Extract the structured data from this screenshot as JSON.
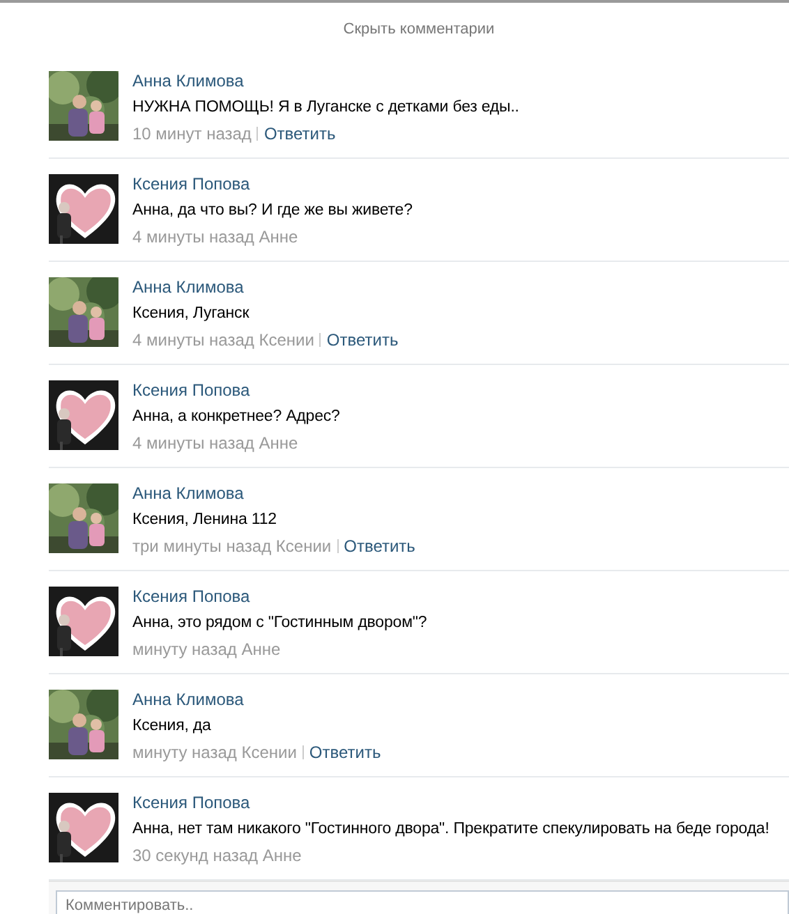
{
  "hide_link": "Скрыть комментарии",
  "comments": [
    {
      "author": "Анна Климова",
      "text": "НУЖНА ПОМОЩЬ! Я в Луганске с детками без еды..",
      "time": "10 минут назад",
      "reply": "Ответить"
    },
    {
      "author": "Ксения Попова",
      "text": "Анна, да что вы? И где же вы живете?",
      "time": "4 минуты назад Анне"
    },
    {
      "author": "Анна Климова",
      "text": "Ксения, Луганск",
      "time": "4 минуты назад Ксении",
      "reply": "Ответить"
    },
    {
      "author": "Ксения Попова",
      "text": "Анна, а конкретнее? Адрес?",
      "time": "4 минуты назад Анне"
    },
    {
      "author": "Анна Климова",
      "text": "Ксения, Ленина 112",
      "time": "три минуты назад Ксении",
      "reply": "Ответить"
    },
    {
      "author": "Ксения Попова",
      "text": "Анна, это рядом с \"Гостинным двором\"?",
      "time": "минуту назад Анне"
    },
    {
      "author": "Анна Климова",
      "text": "Ксения, да",
      "time": "минуту назад Ксении",
      "reply": "Ответить"
    },
    {
      "author": "Ксения Попова",
      "text": "Анна, нет там никакого \"Гостинного двора\". Прекратите спекулировать на беде города!",
      "time": "30 секунд назад Анне"
    }
  ],
  "comment_field": {
    "placeholder": "Комментировать.."
  }
}
